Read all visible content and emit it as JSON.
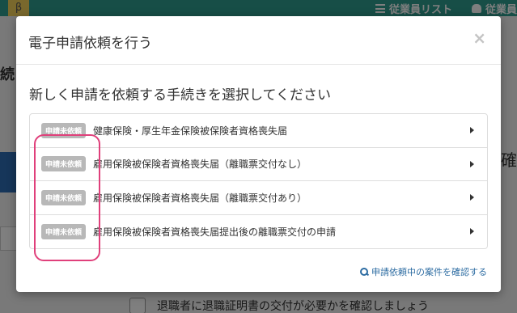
{
  "background": {
    "logo": "β",
    "nav": [
      {
        "icon": "list-icon",
        "label": "従業員リスト"
      },
      {
        "icon": "user-icon",
        "label": "従業員"
      }
    ],
    "left_title": "続",
    "right_text": "確",
    "bottom_row_text": "退職者に退職証明書の交付が必要かを確認しましょう"
  },
  "modal": {
    "title": "電子申請依頼を行う",
    "close_label": "×",
    "section_title": "新しく申請を依頼する手続きを選択してください",
    "items": [
      {
        "badge": "申請未依頼",
        "label": "健康保険・厚生年金保険被保険者資格喪失届"
      },
      {
        "badge": "申請未依頼",
        "label": "雇用保険被保険者資格喪失届（離職票交付なし）"
      },
      {
        "badge": "申請未依頼",
        "label": "雇用保険被保険者資格喪失届（離職票交付あり）"
      },
      {
        "badge": "申請未依頼",
        "label": "雇用保険被保険者資格喪失届提出後の離職票交付の申請"
      }
    ],
    "footer_link": "申請依頼中の案件を確認する"
  },
  "colors": {
    "topbar": "#2f9d8f",
    "badge": "#b8b8b8",
    "highlight": "#e0407b",
    "link": "#2d6ca2"
  }
}
